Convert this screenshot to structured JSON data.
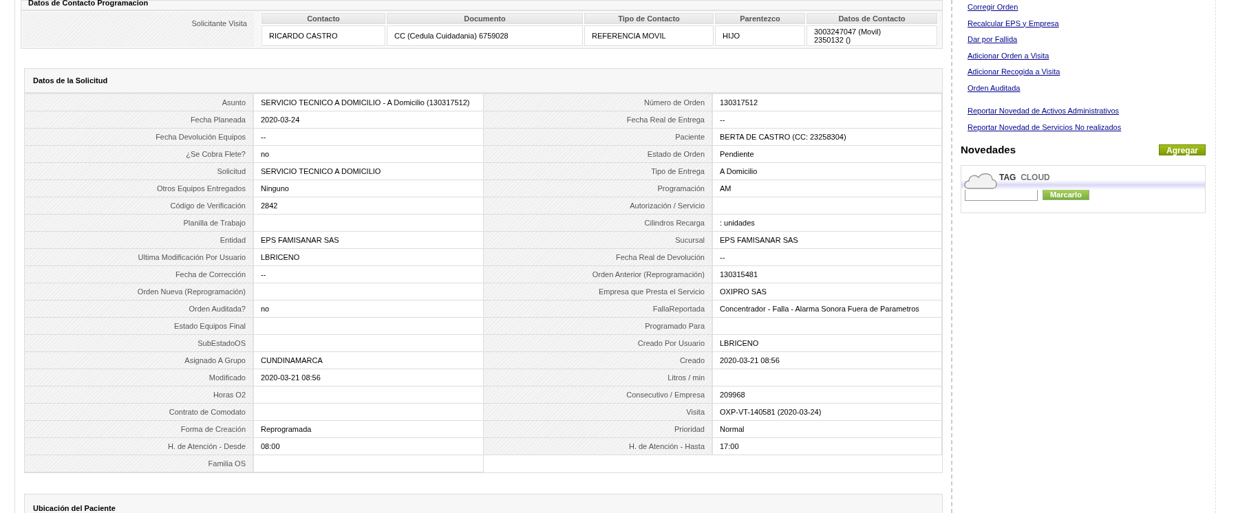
{
  "contact_section": {
    "title": "Datos de Contacto Programacion",
    "row_label": "Solicitante Visita",
    "columns": [
      "Contacto",
      "Documento",
      "Tipo de Contacto",
      "Parentezco",
      "Datos de Contacto"
    ],
    "rows": [
      {
        "cells": [
          "RICARDO CASTRO",
          "CC (Cedula Cuidadania) 6759028",
          "REFERENCIA MOVIL",
          "HIJO"
        ],
        "contact_lines": [
          "3003247047 (Movil)",
          "2350132 ()"
        ]
      }
    ]
  },
  "request_section": {
    "title": "Datos de la Solicitud",
    "left_fields": [
      {
        "label": "Asunto",
        "value": "SERVICIO TECNICO A DOMICILIO - A Domicilio (130317512)"
      },
      {
        "label": "Fecha Planeada",
        "value": "2020-03-24"
      },
      {
        "label": "Fecha Devolución Equipos",
        "value": "--"
      },
      {
        "label": "¿Se Cobra Flete?",
        "value": "no"
      },
      {
        "label": "Solicitud",
        "value": "SERVICIO TECNICO A DOMICILIO"
      },
      {
        "label": "Otros Equipos Entregados",
        "value": "Ninguno"
      },
      {
        "label": "Código de Verificación",
        "value": "2842"
      },
      {
        "label": "Planilla de Trabajo"
      },
      {
        "label": "Entidad",
        "value": "EPS FAMISANAR SAS"
      },
      {
        "label": "Ultima Modificación Por Usuario",
        "value": "LBRICENO"
      },
      {
        "label": "Fecha de Corrección",
        "value": "--"
      },
      {
        "label": "Orden Nueva (Reprogramación)"
      },
      {
        "label": "Orden Auditada?",
        "value": "no"
      },
      {
        "label": "Estado Equipos Final"
      },
      {
        "label": "SubEstadoOS"
      },
      {
        "label": "Asignado A Grupo",
        "value": "CUNDINAMARCA"
      },
      {
        "label": "Modificado",
        "value": "2020-03-21 08:56"
      },
      {
        "label": "Horas O2"
      },
      {
        "label": "Contrato de Comodato"
      },
      {
        "label": "Forma de Creación",
        "value": "Reprogramada"
      },
      {
        "label": "H. de Atención - Desde",
        "value": "08:00"
      },
      {
        "label": "Familia OS"
      }
    ],
    "right_fields": [
      {
        "label": "Número de Orden",
        "value": "130317512"
      },
      {
        "label": "Fecha Real de Entrega",
        "value": "--"
      },
      {
        "label": "Paciente",
        "value": "BERTA DE CASTRO (CC: 23258304)"
      },
      {
        "label": "Estado de Orden",
        "value": "Pendiente"
      },
      {
        "label": "Tipo de Entrega",
        "value": "A Domicilio"
      },
      {
        "label": "Programación",
        "value": "AM"
      },
      {
        "label": "Autorización / Servicio"
      },
      {
        "label": "Cilindros Recarga",
        "value": ": unidades"
      },
      {
        "label": "Sucursal",
        "value": "EPS FAMISANAR SAS"
      },
      {
        "label": "Fecha Real de Devolución",
        "value": "--"
      },
      {
        "label": "Orden Anterior (Reprogramación)",
        "value": "130315481"
      },
      {
        "label": "Empresa que Presta el Servicio",
        "value": "OXIPRO SAS"
      },
      {
        "label": "FallaReportada",
        "value": "Concentrador - Falla - Alarma Sonora Fuera de Parametros"
      },
      {
        "label": "Programado Para"
      },
      {
        "label": "Creado Por Usuario",
        "value": "LBRICENO"
      },
      {
        "label": "Creado",
        "value": "2020-03-21 08:56"
      },
      {
        "label": "Litros / min"
      },
      {
        "label": "Consecutivo / Empresa",
        "value": "209968"
      },
      {
        "label": "Visita",
        "value": "OXP-VT-140581 (2020-03-24)"
      },
      {
        "label": "Prioridad",
        "value": "Normal"
      },
      {
        "label": "H. de Atención - Hasta",
        "value": "17:00"
      }
    ]
  },
  "next_section": {
    "title": "Ubicación del Paciente"
  },
  "sidebar": {
    "action_links": [
      "Corregir Orden",
      "Recalcular EPS y Empresa",
      "Dar por Fallida",
      "Adicionar Orden a Visita",
      "Adicionar Recogida a Visita",
      "Orden Auditada"
    ],
    "report_links": [
      "Reportar Novedad de Activos Administrativos",
      "Reportar Novedad de Servicios No realizados"
    ],
    "novedades": {
      "title": "Novedades",
      "add_button": "Agregar",
      "tag_cloud": {
        "title_word_1": "TAG",
        "title_word_2": "CLOUD",
        "button": "Marcarlo"
      }
    }
  }
}
